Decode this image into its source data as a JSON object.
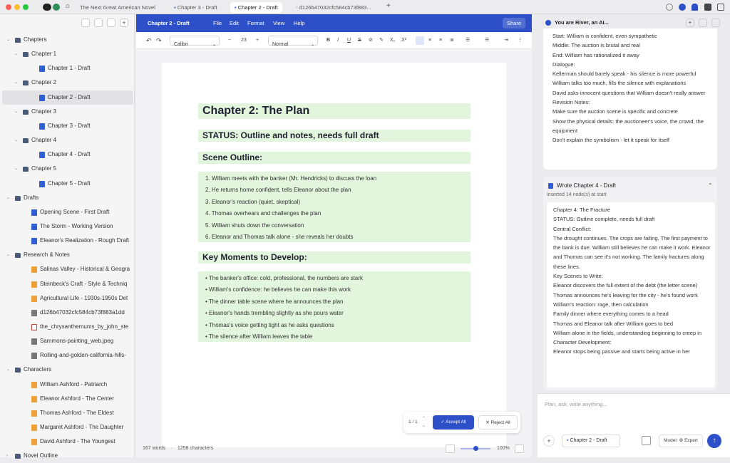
{
  "window": {
    "tabs": [
      "The Next Great American Novel",
      "Chapter 3 - Draft",
      "Chapter 2 - Draft",
      "d126b47032cfc584cb73f883..."
    ]
  },
  "sidebar": {
    "items": [
      {
        "label": "Chapters",
        "icon": "folder-icon",
        "depth": 0,
        "chev": "v"
      },
      {
        "label": "Chapter 1",
        "icon": "folder-icon",
        "depth": 1,
        "chev": "v"
      },
      {
        "label": "Chapter 1 - Draft",
        "icon": "document-icon",
        "depth": 2
      },
      {
        "label": "Chapter 2",
        "icon": "folder-icon",
        "depth": 1,
        "chev": "v"
      },
      {
        "label": "Chapter 2 - Draft",
        "icon": "document-icon",
        "depth": 2,
        "selected": true
      },
      {
        "label": "Chapter 3",
        "icon": "folder-icon",
        "depth": 1,
        "chev": "v"
      },
      {
        "label": "Chapter 3 - Draft",
        "icon": "document-icon",
        "depth": 2
      },
      {
        "label": "Chapter 4",
        "icon": "folder-icon",
        "depth": 1,
        "chev": "v"
      },
      {
        "label": "Chapter 4 - Draft",
        "icon": "document-icon",
        "depth": 2
      },
      {
        "label": "Chapter 5",
        "icon": "folder-icon",
        "depth": 1,
        "chev": "v"
      },
      {
        "label": "Chapter 5 - Draft",
        "icon": "document-icon",
        "depth": 2
      },
      {
        "label": "Drafts",
        "icon": "folder-icon",
        "depth": 0,
        "chev": "v"
      },
      {
        "label": "Opening Scene - First Draft",
        "icon": "document-icon",
        "depth": 1
      },
      {
        "label": "The Storm - Working Version",
        "icon": "document-icon",
        "depth": 1
      },
      {
        "label": "Eleanor's Realization - Rough Draft",
        "icon": "document-icon",
        "depth": 1
      },
      {
        "label": "Research & Notes",
        "icon": "folder-icon",
        "depth": 0,
        "chev": "v"
      },
      {
        "label": "Salinas Valley - Historical & Geogra",
        "icon": "note-icon",
        "depth": 1
      },
      {
        "label": "Steinbeck's Craft - Style & Techniq",
        "icon": "note-icon",
        "depth": 1
      },
      {
        "label": "Agricultural Life - 1930s-1950s Det",
        "icon": "note-icon",
        "depth": 1
      },
      {
        "label": "d126b47032cfc584cb73f883a1dd",
        "icon": "image-icon",
        "depth": 1
      },
      {
        "label": "the_chrysanthemums_by_john_ste",
        "icon": "pdf-icon",
        "depth": 1
      },
      {
        "label": "Sammons-painting_web.jpeg",
        "icon": "image-icon",
        "depth": 1
      },
      {
        "label": "Rolling-and-golden-california-hills-",
        "icon": "image-icon",
        "depth": 1
      },
      {
        "label": "Characters",
        "icon": "folder-icon",
        "depth": 0,
        "chev": "v"
      },
      {
        "label": "William Ashford - Patriarch",
        "icon": "note-icon",
        "depth": 1
      },
      {
        "label": "Eleanor Ashford - The Center",
        "icon": "note-icon",
        "depth": 1
      },
      {
        "label": "Thomas Ashford - The Eldest",
        "icon": "note-icon",
        "depth": 1
      },
      {
        "label": "Margaret Ashford - The Daughter",
        "icon": "note-icon",
        "depth": 1
      },
      {
        "label": "David Ashford - The Youngest",
        "icon": "note-icon",
        "depth": 1
      },
      {
        "label": "Novel Outline",
        "icon": "folder-icon",
        "depth": 0,
        "chev": ">"
      }
    ]
  },
  "editor": {
    "title": "Chapter 2 - Draft",
    "menu": [
      "File",
      "Edit",
      "Format",
      "View",
      "Help"
    ],
    "share": "Share",
    "font": "Calibri",
    "size": "23",
    "style": "Normal",
    "doc": {
      "h1": "Chapter 2: The Plan",
      "status": "STATUS: Outline and notes, needs full draft",
      "h_scene": "Scene Outline:",
      "scene": [
        "1. William meets with the banker (Mr. Hendricks) to discuss the loan",
        "2. He returns home confident, tells Eleanor about the plan",
        "3. Eleanor's reaction (quiet, skeptical)",
        "4. Thomas overhears and challenges the plan",
        "5. William shuts down the conversation",
        "6. Eleanor and Thomas talk alone - she reveals her doubts"
      ],
      "h_moments": "Key Moments to Develop:",
      "moments": [
        "The banker's office: cold, professional, the numbers are stark",
        "William's confidence: he believes he can make this work",
        "The dinner table scene where he announces the plan",
        "Eleanor's hands trembling slightly as she pours water",
        "Thomas's voice getting tight as he asks questions",
        "The silence after William leaves the table"
      ]
    },
    "words": "167 words",
    "chars": "1258 characters",
    "zoom": "100%",
    "review": {
      "count": "1 / 1",
      "accept": "Accept All",
      "reject": "Reject All"
    }
  },
  "assistant": {
    "header": "You are River, an AI...",
    "card1": [
      "Start: William is confident, even sympathetic",
      "Middle: The auction is brutal and real",
      "End: William has rationalized it away",
      "Dialogue:",
      "Kellerman should barely speak - his silence is more powerful",
      "William talks too much, fills the silence with explanations",
      "David asks innocent questions that William doesn't really answer",
      "Revision Notes:",
      "Make sure the auction scene is specific and concrete",
      "Show the physical details: the auctioneer's voice, the crowd, the equipment",
      "Don't explain the symbolism - let it speak for itself"
    ],
    "action": {
      "title": "Wrote Chapter 4 - Draft",
      "sub": "inserted 14 node(s) at start"
    },
    "card2": [
      "Chapter 4: The Fracture",
      "STATUS: Outline complete, needs full draft",
      "Central Conflict:",
      "The drought continues. The crops are failing. The first payment to the bank is due. William still believes he can make it work. Eleanor and Thomas can see it's not working. The family fractures along these lines.",
      "Key Scenes to Write:",
      "Eleanor discovers the full extent of the debt (the letter scene)",
      "Thomas announces he's leaving for the city - he's found work",
      "William's reaction: rage, then calculation",
      "Family dinner where everything comes to a head",
      "Thomas and Eleanor talk after William goes to bed",
      "William alone in the fields, understanding beginning to creep in",
      "Character Development:",
      "Eleanor stops being passive and starts being active in her"
    ],
    "placeholder": "Plan, ask, write anything...",
    "context_chip": "Chapter 2 - Draft",
    "model": "Model: ⚙ Expert"
  }
}
